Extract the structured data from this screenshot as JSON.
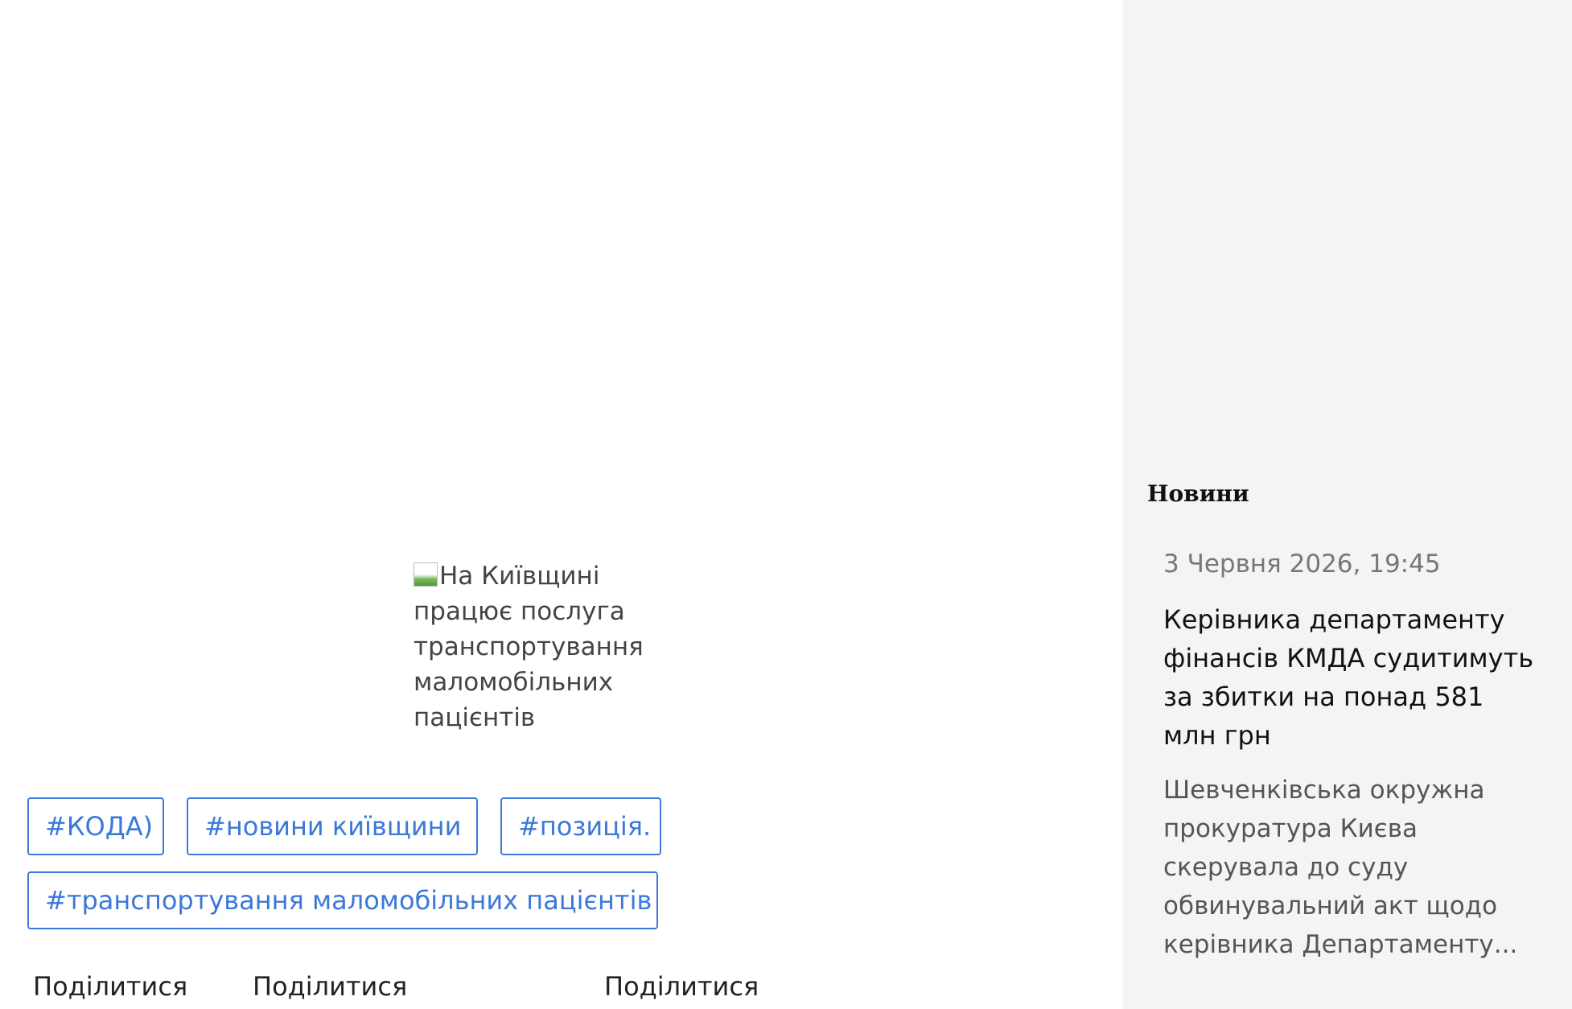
{
  "article": {
    "image_alt": "На Київщині працює послуга транспортування маломобільних пацієнтів",
    "tags": [
      "#КОДА)",
      "#новини київщини",
      "#позиція.",
      "#транспортування маломобільних пацієнтів"
    ],
    "share_labels": [
      "Поділитися",
      "Поділитися",
      "Поділитися"
    ]
  },
  "sidebar": {
    "section_title": "Новини",
    "news": [
      {
        "date": "3 Червня 2026, 19:45",
        "title": "Керівника департаменту фінансів КМДА судитимуть за збитки на понад 581 млн грн",
        "excerpt": "Шевченківська окружна прокуратура Києва скерувала до суду обвинувальний акт щодо керівника Департаменту..."
      }
    ]
  },
  "colors": {
    "tag_accent": "#3b78d8",
    "sidebar_bg": "#f4f4f4",
    "date_gray": "#777777"
  },
  "icons": {
    "broken_image": "broken-image-icon"
  }
}
